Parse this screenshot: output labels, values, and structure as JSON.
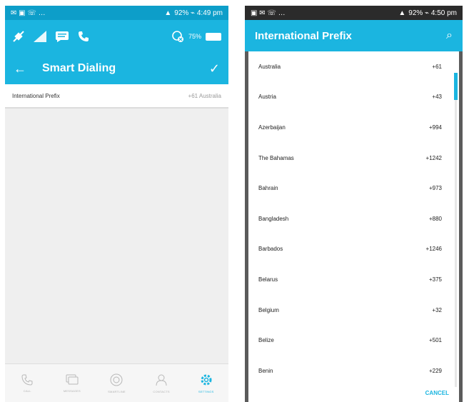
{
  "left": {
    "status": {
      "left_icons": "✉ ▣ ☏ …",
      "right_text": "92% ⌁ 4:49 pm"
    },
    "toolbar": {
      "percentage": "75%"
    },
    "appbar": {
      "back": "←",
      "title": "Smart Dialing",
      "check": "✓"
    },
    "setting": {
      "label": "International Prefix",
      "value": "+61  Australia"
    },
    "nav": [
      "CALL",
      "MESSAGES",
      "SMARTLINE",
      "CONTACTS",
      "SETTINGS"
    ]
  },
  "right": {
    "status": {
      "left_icons": "▣ ✉ ☏ …",
      "right_text": "92% ⌁ 4:50 pm"
    },
    "header": {
      "title": "International Prefix",
      "search_icon": "⌕"
    },
    "items": [
      {
        "country": "Australia",
        "code": "+61"
      },
      {
        "country": "Austria",
        "code": "+43"
      },
      {
        "country": "Azerbaijan",
        "code": "+994"
      },
      {
        "country": "The Bahamas",
        "code": "+1242"
      },
      {
        "country": "Bahrain",
        "code": "+973"
      },
      {
        "country": "Bangladesh",
        "code": "+880"
      },
      {
        "country": "Barbados",
        "code": "+1246"
      },
      {
        "country": "Belarus",
        "code": "+375"
      },
      {
        "country": "Belgium",
        "code": "+32"
      },
      {
        "country": "Belize",
        "code": "+501"
      },
      {
        "country": "Benin",
        "code": "+229"
      }
    ],
    "cancel": "CANCEL"
  },
  "colors": {
    "accent": "#1bb5e0",
    "status_left": "#0d9ec9",
    "status_right": "#2b2b2b"
  }
}
